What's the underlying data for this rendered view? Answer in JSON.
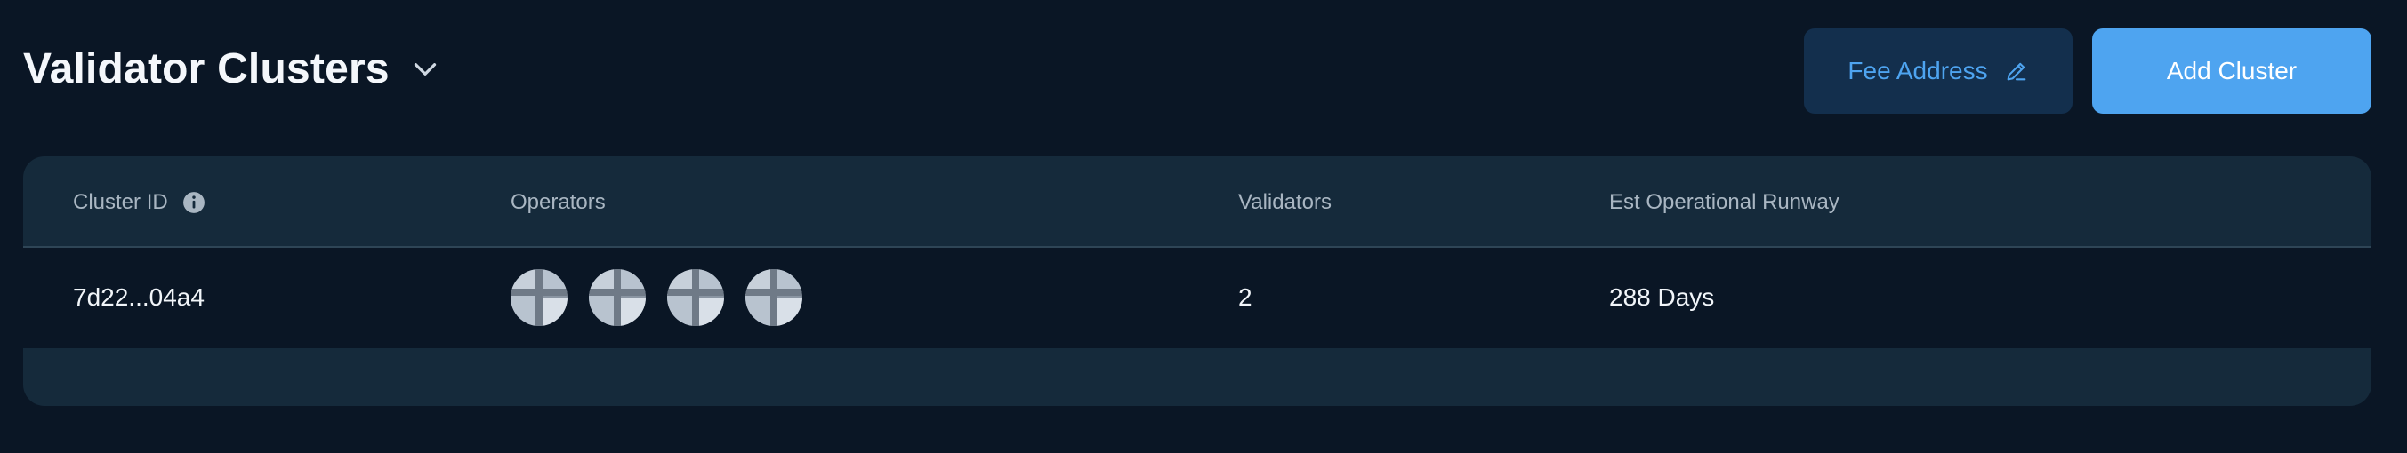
{
  "header": {
    "title": "Validator Clusters",
    "title_dropdown_icon": "chevron-down-icon",
    "fee_address_label": "Fee Address",
    "fee_address_icon": "pencil-icon",
    "add_cluster_label": "Add Cluster"
  },
  "table": {
    "columns": {
      "cluster_id": "Cluster ID",
      "cluster_id_info_icon": "info-icon",
      "operators": "Operators",
      "validators": "Validators",
      "runway": "Est Operational Runway"
    },
    "rows": [
      {
        "cluster_id": "7d22...04a4",
        "operators": [
          "operator-avatar",
          "operator-avatar",
          "operator-avatar",
          "operator-avatar"
        ],
        "validators": "2",
        "runway": "288 Days"
      }
    ]
  },
  "colors": {
    "background": "#0a1625",
    "card": "#152a3b",
    "accent": "#4ea4f0",
    "accent_dark": "#132f4d"
  }
}
